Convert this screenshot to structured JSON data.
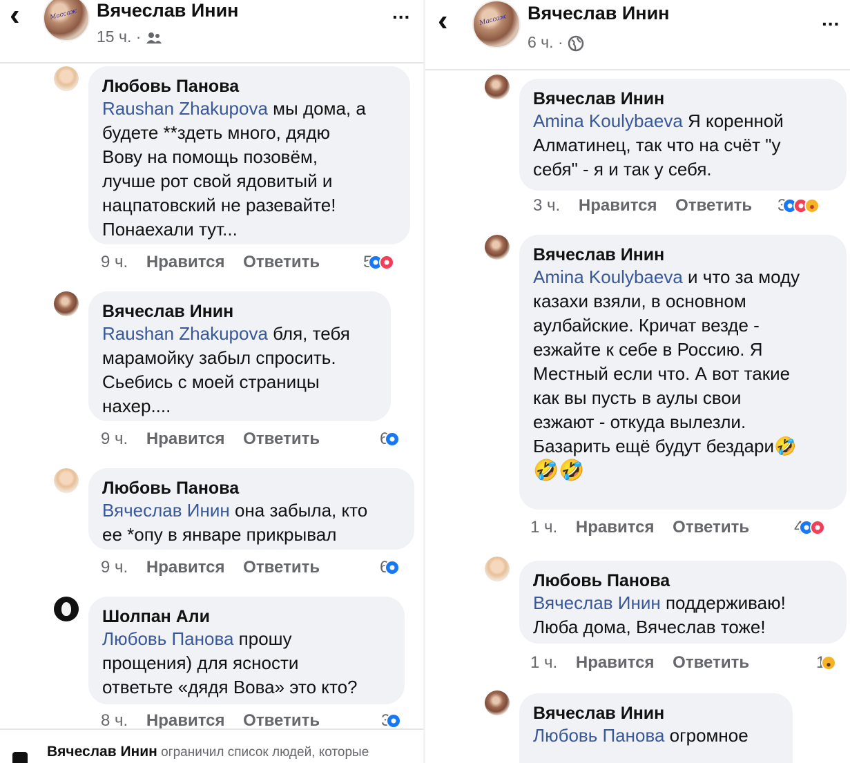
{
  "left": {
    "header": {
      "name": "Вячеслав Инин",
      "time": "15 ч. ·",
      "audience_icon": "friends-icon",
      "more": "..."
    },
    "comments": [
      {
        "author": "Любовь Панова",
        "avatar": "lyubov",
        "mention": "Raushan Zhakupova",
        "lines": [
          " мы дома, а",
          "будете **здеть много, дядю",
          "Вову на помощь позовём,",
          "лучше рот свой ядовитый и",
          "нацпатовский не разевайте!",
          "Понаехали тут..."
        ],
        "time": "9 ч.",
        "like": "Нравится",
        "reply": "Ответить",
        "reaction_count": "5",
        "reactions": [
          "like-icon",
          "love-icon"
        ]
      },
      {
        "author": "Вячеслав Инин",
        "avatar": "vyach",
        "mention": "Raushan Zhakupova",
        "lines": [
          " бля, тебя",
          "марамойку забыл спросить.",
          "Сьебись с моей страницы",
          "нахер...."
        ],
        "time": "9 ч.",
        "like": "Нравится",
        "reply": "Ответить",
        "reaction_count": "6",
        "reactions": [
          "like-icon"
        ]
      },
      {
        "author": "Любовь Панова",
        "avatar": "lyubov",
        "mention": "Вячеслав Инин",
        "lines": [
          " она забыла, кто",
          "ее *опу в январе прикрывал"
        ],
        "time": "9 ч.",
        "like": "Нравится",
        "reply": "Ответить",
        "reaction_count": "6",
        "reactions": [
          "like-icon"
        ]
      },
      {
        "author": "Шолпан Али",
        "avatar": "sholpan",
        "mention": "Любовь Панова",
        "lines": [
          " прошу",
          "прощения) для ясности",
          "ответьте «дядя Вова» это кто?"
        ],
        "time": "8 ч.",
        "like": "Нравится",
        "reply": "Ответить",
        "reaction_count": "3",
        "reactions": [
          "like-icon"
        ]
      }
    ],
    "footer": {
      "name": "Вячеслав Инин",
      "text": " ограничил список людей, которые"
    }
  },
  "right": {
    "header": {
      "name": "Вячеслав Инин",
      "time": "6 ч. ·",
      "audience_icon": "globe-icon",
      "more": "..."
    },
    "comments": [
      {
        "author": "Вячеслав Инин",
        "avatar": "vyach",
        "mention": "Amina Koulybaeva",
        "lines": [
          " Я коренной",
          "Алматинец, так что на счёт \"у",
          "себя\" - я и так у себя."
        ],
        "time": "3 ч.",
        "like": "Нравится",
        "reply": "Ответить",
        "reaction_count": "3",
        "reactions": [
          "like-icon",
          "love-icon",
          "haha-icon"
        ]
      },
      {
        "author": "Вячеслав Инин",
        "avatar": "vyach",
        "mention": "Amina Koulybaeva",
        "lines": [
          " и что за моду",
          "казахи взяли, в основном",
          "аулбайские. Кричат везде -",
          "езжайте к себе в Россию. Я",
          "Местный если что. А вот такие",
          "как вы пусть в аулы свои",
          "езжают - откуда вылезли.",
          "Базарить ещё будут бездари🤣"
        ],
        "emoji_line": "🤣🤣",
        "time": "1 ч.",
        "like": "Нравится",
        "reply": "Ответить",
        "reaction_count": "4",
        "reactions": [
          "like-icon",
          "love-icon"
        ]
      },
      {
        "author": "Любовь Панова",
        "avatar": "lyubov",
        "mention": "Вячеслав Инин",
        "lines": [
          " поддерживаю!",
          "Люба дома, Вячеслав тоже!"
        ],
        "time": "1 ч.",
        "like": "Нравится",
        "reply": "Ответить",
        "reaction_count": "1",
        "reactions": [
          "wow-icon"
        ]
      },
      {
        "author": "Вячеслав Инин",
        "avatar": "vyach",
        "mention": "Любовь Панова",
        "lines": [
          " огромное"
        ],
        "time": "",
        "like": "",
        "reply": "",
        "reaction_count": "",
        "reactions": []
      }
    ]
  },
  "colors": {
    "mention": "#385898",
    "bubble": "#f0f2f5",
    "meta": "#65676b",
    "like": "#1877f2",
    "love": "#f33e58"
  }
}
